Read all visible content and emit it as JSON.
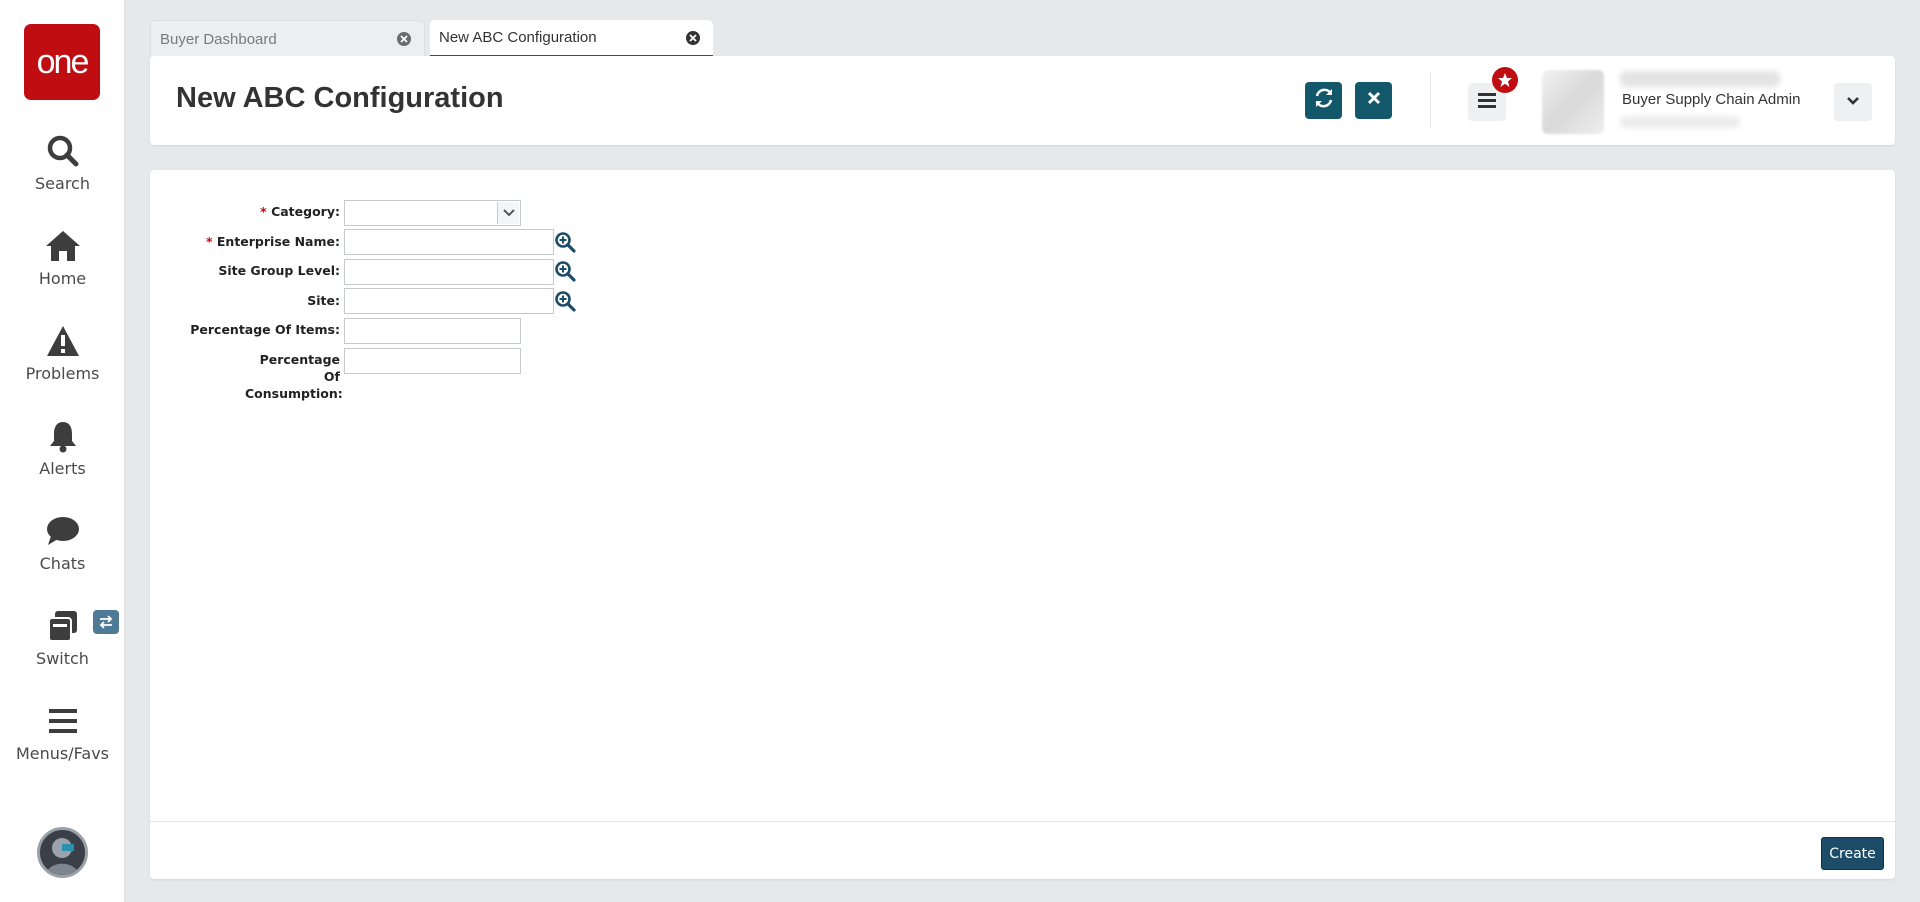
{
  "sidebar": {
    "logo_text": "one",
    "items": [
      {
        "label": "Search",
        "icon": "search-icon"
      },
      {
        "label": "Home",
        "icon": "home-icon"
      },
      {
        "label": "Problems",
        "icon": "warning-icon"
      },
      {
        "label": "Alerts",
        "icon": "bell-icon"
      },
      {
        "label": "Chats",
        "icon": "chat-icon"
      },
      {
        "label": "Switch",
        "icon": "switch-icon"
      },
      {
        "label": "Menus/Favs",
        "icon": "hamburger-icon"
      }
    ]
  },
  "tabs": [
    {
      "label": "Buyer Dashboard",
      "active": false
    },
    {
      "label": "New ABC Configuration",
      "active": true
    }
  ],
  "header": {
    "title": "New ABC Configuration",
    "user_role": "Buyer Supply Chain Admin"
  },
  "form": {
    "fields": [
      {
        "label": "Category:",
        "required": true,
        "type": "select",
        "value": ""
      },
      {
        "label": "Enterprise Name:",
        "required": true,
        "type": "lookup",
        "value": ""
      },
      {
        "label": "Site Group Level:",
        "required": false,
        "type": "lookup",
        "value": ""
      },
      {
        "label": "Site:",
        "required": false,
        "type": "lookup",
        "value": ""
      },
      {
        "label": "Percentage Of Items:",
        "required": false,
        "type": "text",
        "value": ""
      },
      {
        "label": "Percentage Of Consumption:",
        "required": false,
        "type": "text",
        "value": ""
      }
    ],
    "required_marker": "*"
  },
  "footer": {
    "create_label": "Create"
  },
  "colors": {
    "brand_red": "#c00d12",
    "accent_teal": "#13586a",
    "button_navy": "#1c4c68"
  }
}
